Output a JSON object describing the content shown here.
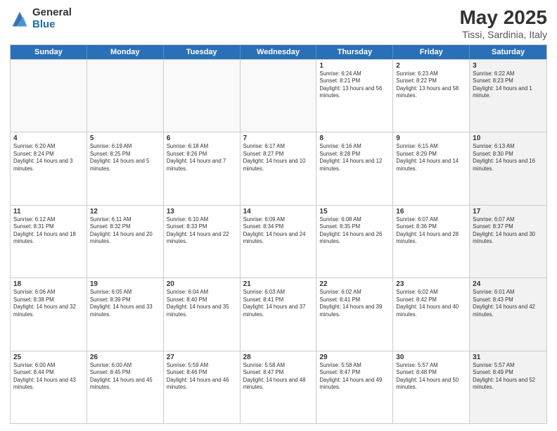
{
  "logo": {
    "general": "General",
    "blue": "Blue"
  },
  "title": "May 2025",
  "subtitle": "Tissi, Sardinia, Italy",
  "days": [
    "Sunday",
    "Monday",
    "Tuesday",
    "Wednesday",
    "Thursday",
    "Friday",
    "Saturday"
  ],
  "rows": [
    [
      {
        "day": "",
        "empty": true
      },
      {
        "day": "",
        "empty": true
      },
      {
        "day": "",
        "empty": true
      },
      {
        "day": "",
        "empty": true
      },
      {
        "day": "1",
        "sunrise": "6:24 AM",
        "sunset": "8:21 PM",
        "daylight": "13 hours and 56 minutes."
      },
      {
        "day": "2",
        "sunrise": "6:23 AM",
        "sunset": "8:22 PM",
        "daylight": "13 hours and 58 minutes."
      },
      {
        "day": "3",
        "sunrise": "6:22 AM",
        "sunset": "8:23 PM",
        "daylight": "14 hours and 1 minute.",
        "shaded": true
      }
    ],
    [
      {
        "day": "4",
        "sunrise": "6:20 AM",
        "sunset": "8:24 PM",
        "daylight": "14 hours and 3 minutes."
      },
      {
        "day": "5",
        "sunrise": "6:19 AM",
        "sunset": "8:25 PM",
        "daylight": "14 hours and 5 minutes."
      },
      {
        "day": "6",
        "sunrise": "6:18 AM",
        "sunset": "8:26 PM",
        "daylight": "14 hours and 7 minutes."
      },
      {
        "day": "7",
        "sunrise": "6:17 AM",
        "sunset": "8:27 PM",
        "daylight": "14 hours and 10 minutes."
      },
      {
        "day": "8",
        "sunrise": "6:16 AM",
        "sunset": "8:28 PM",
        "daylight": "14 hours and 12 minutes."
      },
      {
        "day": "9",
        "sunrise": "6:15 AM",
        "sunset": "8:29 PM",
        "daylight": "14 hours and 14 minutes."
      },
      {
        "day": "10",
        "sunrise": "6:13 AM",
        "sunset": "8:30 PM",
        "daylight": "14 hours and 16 minutes.",
        "shaded": true
      }
    ],
    [
      {
        "day": "11",
        "sunrise": "6:12 AM",
        "sunset": "8:31 PM",
        "daylight": "14 hours and 18 minutes."
      },
      {
        "day": "12",
        "sunrise": "6:11 AM",
        "sunset": "8:32 PM",
        "daylight": "14 hours and 20 minutes."
      },
      {
        "day": "13",
        "sunrise": "6:10 AM",
        "sunset": "8:33 PM",
        "daylight": "14 hours and 22 minutes."
      },
      {
        "day": "14",
        "sunrise": "6:09 AM",
        "sunset": "8:34 PM",
        "daylight": "14 hours and 24 minutes."
      },
      {
        "day": "15",
        "sunrise": "6:08 AM",
        "sunset": "8:35 PM",
        "daylight": "14 hours and 26 minutes."
      },
      {
        "day": "16",
        "sunrise": "6:07 AM",
        "sunset": "8:36 PM",
        "daylight": "14 hours and 28 minutes."
      },
      {
        "day": "17",
        "sunrise": "6:07 AM",
        "sunset": "8:37 PM",
        "daylight": "14 hours and 30 minutes.",
        "shaded": true
      }
    ],
    [
      {
        "day": "18",
        "sunrise": "6:06 AM",
        "sunset": "8:38 PM",
        "daylight": "14 hours and 32 minutes."
      },
      {
        "day": "19",
        "sunrise": "6:05 AM",
        "sunset": "8:39 PM",
        "daylight": "14 hours and 33 minutes."
      },
      {
        "day": "20",
        "sunrise": "6:04 AM",
        "sunset": "8:40 PM",
        "daylight": "14 hours and 35 minutes."
      },
      {
        "day": "21",
        "sunrise": "6:03 AM",
        "sunset": "8:41 PM",
        "daylight": "14 hours and 37 minutes."
      },
      {
        "day": "22",
        "sunrise": "6:02 AM",
        "sunset": "8:41 PM",
        "daylight": "14 hours and 39 minutes."
      },
      {
        "day": "23",
        "sunrise": "6:02 AM",
        "sunset": "8:42 PM",
        "daylight": "14 hours and 40 minutes."
      },
      {
        "day": "24",
        "sunrise": "6:01 AM",
        "sunset": "8:43 PM",
        "daylight": "14 hours and 42 minutes.",
        "shaded": true
      }
    ],
    [
      {
        "day": "25",
        "sunrise": "6:00 AM",
        "sunset": "8:44 PM",
        "daylight": "14 hours and 43 minutes."
      },
      {
        "day": "26",
        "sunrise": "6:00 AM",
        "sunset": "8:45 PM",
        "daylight": "14 hours and 45 minutes."
      },
      {
        "day": "27",
        "sunrise": "5:59 AM",
        "sunset": "8:46 PM",
        "daylight": "14 hours and 46 minutes."
      },
      {
        "day": "28",
        "sunrise": "5:58 AM",
        "sunset": "8:47 PM",
        "daylight": "14 hours and 48 minutes."
      },
      {
        "day": "29",
        "sunrise": "5:58 AM",
        "sunset": "8:47 PM",
        "daylight": "14 hours and 49 minutes."
      },
      {
        "day": "30",
        "sunrise": "5:57 AM",
        "sunset": "8:48 PM",
        "daylight": "14 hours and 50 minutes."
      },
      {
        "day": "31",
        "sunrise": "5:57 AM",
        "sunset": "8:49 PM",
        "daylight": "14 hours and 52 minutes.",
        "shaded": true
      }
    ]
  ]
}
